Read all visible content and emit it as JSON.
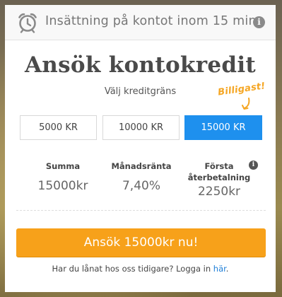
{
  "banner": {
    "icon": "alarm-clock-icon",
    "text": "Insättning på kontot inom 15 min.",
    "info_icon": "info-icon"
  },
  "card": {
    "title": "Ansök kontokredit",
    "subtitle": "Välj kreditgräns",
    "badge": "Billigast!",
    "options": [
      {
        "label": "5000 KR",
        "selected": false
      },
      {
        "label": "10000 KR",
        "selected": false
      },
      {
        "label": "15000 KR",
        "selected": true
      }
    ],
    "summary": {
      "sum_label": "Summa",
      "sum_value": "15000kr",
      "rate_label": "Månadsränta",
      "rate_value": "7,40%",
      "first_label": "Första återbetalning",
      "first_value": "2250kr"
    },
    "cta": "Ansök 15000kr nu!",
    "footer_text": "Har du lånat hos oss tidigare? Logga in",
    "footer_link": "här",
    "footer_end": "."
  },
  "colors": {
    "accent_blue": "#1e90ee",
    "cta_orange": "#f7a11a",
    "badge_orange": "#f5a623"
  }
}
